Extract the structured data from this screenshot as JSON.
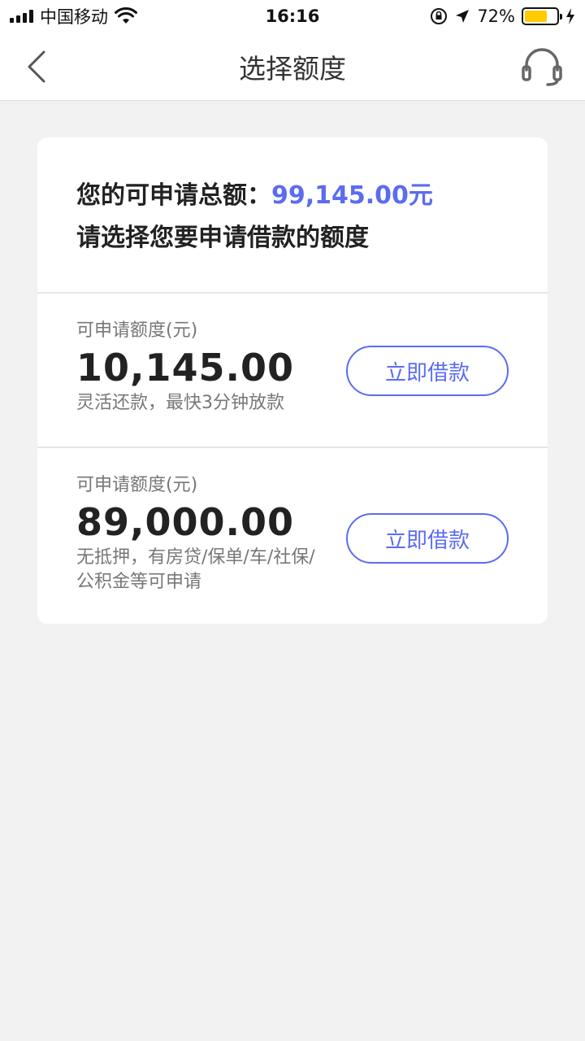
{
  "status_bar": {
    "carrier": "中国移动",
    "time": "16:16",
    "battery_percent": "72%",
    "battery_level": 0.72
  },
  "nav": {
    "title": "选择额度",
    "back_icon": "chevron-left-icon",
    "service_icon": "headset-icon"
  },
  "summary": {
    "total_label": "您的可申请总额：",
    "total_amount": "99,145.00元",
    "subtitle": "请选择您要申请借款的额度"
  },
  "options": [
    {
      "label": "可申请额度(元)",
      "amount": "10,145.00",
      "description": "灵活还款，最快3分钟放款",
      "button_label": "立即借款"
    },
    {
      "label": "可申请额度(元)",
      "amount": "89,000.00",
      "description": "无抵押，有房贷/保单/车/社保/公积金等可申请",
      "button_label": "立即借款"
    }
  ],
  "colors": {
    "accent": "#5b6cf0",
    "background": "#f2f2f2",
    "battery": "#ffcc00"
  }
}
